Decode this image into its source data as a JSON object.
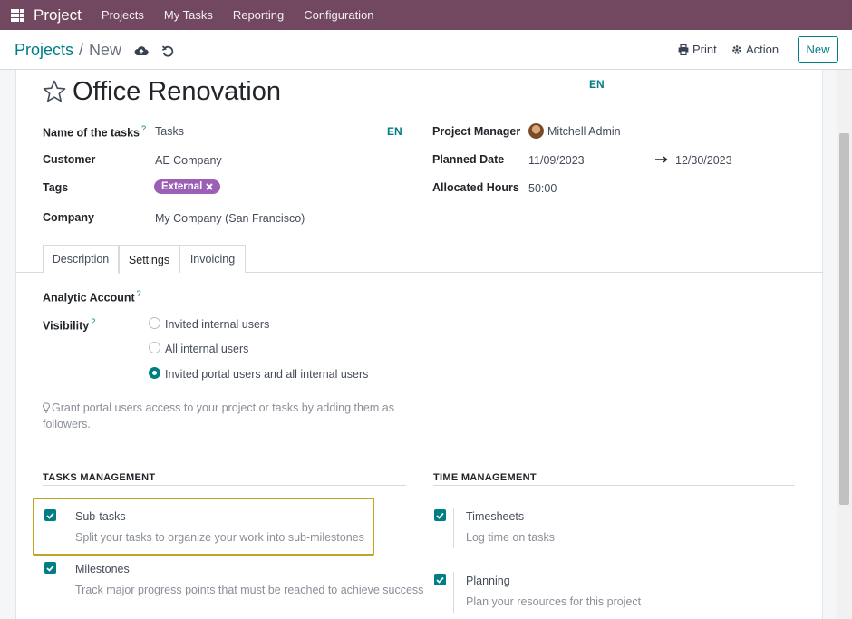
{
  "navbar": {
    "brand": "Project",
    "items": [
      "Projects",
      "My Tasks",
      "Reporting",
      "Configuration"
    ]
  },
  "breadcrumb": {
    "parent": "Projects",
    "separator": "/",
    "current": "New"
  },
  "toolbar": {
    "print_label": "Print",
    "action_label": "Action",
    "new_label": "New"
  },
  "record": {
    "title": "Office Renovation",
    "lang_badge": "EN",
    "fields_left": {
      "tasks_name_label": "Name of the tasks",
      "tasks_name_value": "Tasks",
      "tasks_name_lang": "EN",
      "customer_label": "Customer",
      "customer_value": "AE Company",
      "tags_label": "Tags",
      "tag_value": "External",
      "company_label": "Company",
      "company_value": "My Company (San Francisco)"
    },
    "fields_right": {
      "manager_label": "Project Manager",
      "manager_value": "Mitchell Admin",
      "planned_date_label": "Planned Date",
      "planned_start": "11/09/2023",
      "planned_end": "12/30/2023",
      "allocated_hours_label": "Allocated Hours",
      "allocated_hours_value": "50:00"
    }
  },
  "tabs": [
    {
      "label": "Description",
      "active": false
    },
    {
      "label": "Settings",
      "active": true
    },
    {
      "label": "Invoicing",
      "active": false
    }
  ],
  "settings": {
    "analytic_account_label": "Analytic Account",
    "visibility_label": "Visibility",
    "visibility_options": [
      {
        "label": "Invited internal users",
        "checked": false
      },
      {
        "label": "All internal users",
        "checked": false
      },
      {
        "label": "Invited portal users and all internal users",
        "checked": true
      }
    ],
    "hint_line1": "Grant portal users access to your project or tasks by adding them as",
    "hint_line2": "followers.",
    "tasks_management": {
      "heading": "TASKS MANAGEMENT",
      "items": [
        {
          "title": "Sub-tasks",
          "desc": "Split your tasks to organize your work into sub-milestones",
          "checked": true
        },
        {
          "title": "Milestones",
          "desc": "Track major progress points that must be reached to achieve success",
          "checked": true
        }
      ]
    },
    "time_management": {
      "heading": "TIME MANAGEMENT",
      "items": [
        {
          "title": "Timesheets",
          "desc": "Log time on tasks",
          "checked": true
        },
        {
          "title": "Planning",
          "desc": "Plan your resources for this project",
          "checked": true
        }
      ]
    }
  },
  "colors": {
    "navbar": "#71485f",
    "accent": "#017e84",
    "tag": "#9b5fb6",
    "highlight_box": "#bfa523"
  }
}
